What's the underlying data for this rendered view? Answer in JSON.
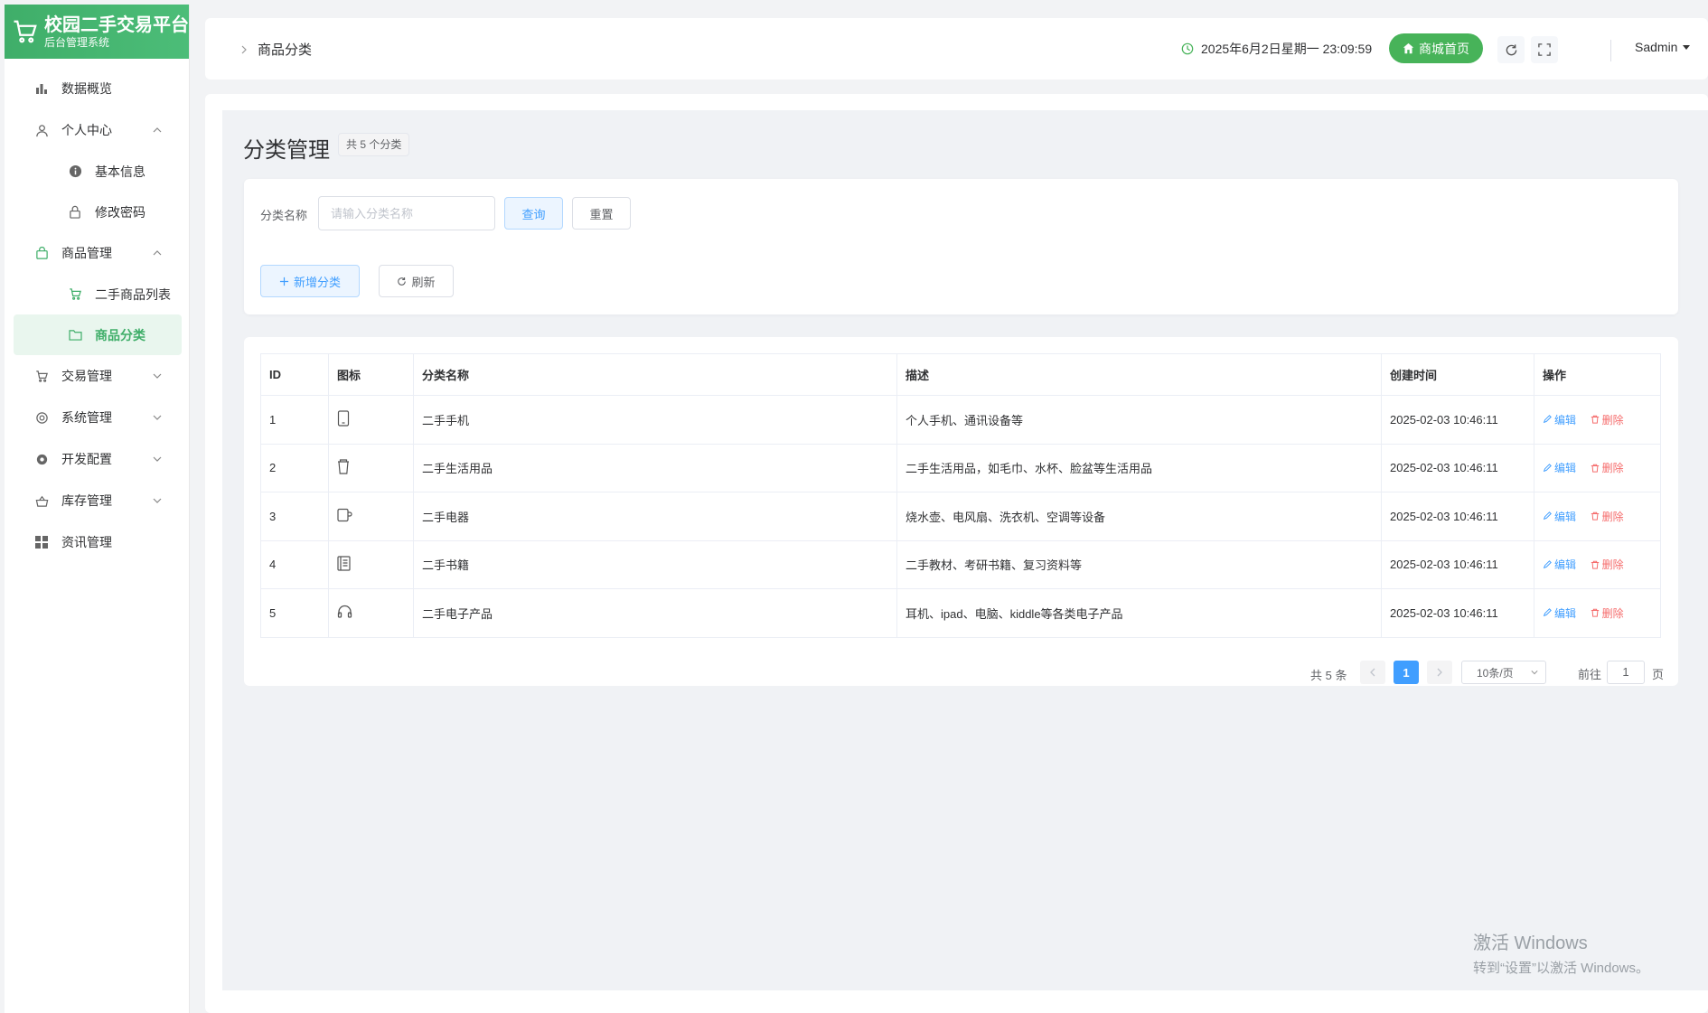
{
  "brand": {
    "title": "校园二手交易平台",
    "subtitle": "后台管理系统"
  },
  "sidebar": {
    "items": [
      {
        "label": "数据概览"
      },
      {
        "label": "个人中心"
      },
      {
        "label": "基本信息"
      },
      {
        "label": "修改密码"
      },
      {
        "label": "商品管理"
      },
      {
        "label": "二手商品列表"
      },
      {
        "label": "商品分类"
      },
      {
        "label": "交易管理"
      },
      {
        "label": "系统管理"
      },
      {
        "label": "开发配置"
      },
      {
        "label": "库存管理"
      },
      {
        "label": "资讯管理"
      }
    ]
  },
  "header": {
    "breadcrumb": "商品分类",
    "datetime": "2025年6月2日星期一 23:09:59",
    "home_label": "商城首页",
    "user": "Sadmin"
  },
  "page": {
    "title": "分类管理",
    "count_tag": "共 5 个分类"
  },
  "search": {
    "label": "分类名称",
    "placeholder": "请输入分类名称",
    "query_label": "查询",
    "reset_label": "重置",
    "add_label": "新增分类",
    "refresh_label": "刷新"
  },
  "table": {
    "headers": [
      "ID",
      "图标",
      "分类名称",
      "描述",
      "创建时间",
      "操作"
    ],
    "rows": [
      {
        "id": "1",
        "icon": "phone-icon",
        "name": "二手手机",
        "desc": "个人手机、通讯设备等",
        "created": "2025-02-03 10:46:11"
      },
      {
        "id": "2",
        "icon": "cup-icon",
        "name": "二手生活用品",
        "desc": "二手生活用品，如毛巾、水杯、脸盆等生活用品",
        "created": "2025-02-03 10:46:11"
      },
      {
        "id": "3",
        "icon": "mug-icon",
        "name": "二手电器",
        "desc": "烧水壶、电风扇、洗衣机、空调等设备",
        "created": "2025-02-03 10:46:11"
      },
      {
        "id": "4",
        "icon": "notebook-icon",
        "name": "二手书籍",
        "desc": "二手教材、考研书籍、复习资料等",
        "created": "2025-02-03 10:46:11"
      },
      {
        "id": "5",
        "icon": "headset-icon",
        "name": "二手电子产品",
        "desc": "耳机、ipad、电脑、kiddle等各类电子产品",
        "created": "2025-02-03 10:46:11"
      }
    ],
    "edit_label": "编辑",
    "delete_label": "删除"
  },
  "pager": {
    "total": "共 5 条",
    "current": "1",
    "page_size": "10条/页",
    "goto_label": "前往",
    "goto_value": "1",
    "page_suffix": "页"
  },
  "watermark": {
    "line1": "激活 Windows",
    "line2": "转到“设置”以激活 Windows。"
  },
  "colors": {
    "brand": "#47b359",
    "primary": "#409eff",
    "danger": "#f56c6c"
  }
}
